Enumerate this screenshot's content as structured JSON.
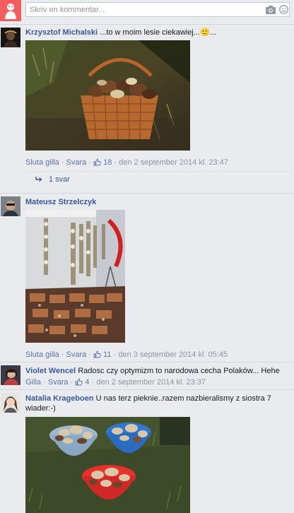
{
  "composer": {
    "placeholder": "Skriv en kommentar..."
  },
  "comments": [
    {
      "author": "Krzysztof Michalski",
      "text": "...to w moim lesie ciekawiej...",
      "emoji": "🙂",
      "text_tail": "...",
      "actions": {
        "hide": "Sluta gilla",
        "reply": "Svara",
        "likes": "18",
        "date": "den 2 september 2014 kl. 23:47"
      },
      "replies_label": "1 svar"
    },
    {
      "author": "Mateusz Strzelczyk",
      "text": "",
      "actions": {
        "hide": "Sluta gilla",
        "reply": "Svara",
        "likes": "11",
        "date": "den 3 september 2014 kl. 05:45"
      }
    },
    {
      "author": "Violet Wencel",
      "text": "Radosc czy optymizm to narodowa cecha Polaków... Hehe",
      "actions": {
        "hide": "Gilla",
        "reply": "Svara",
        "likes": "4",
        "date": "den 2 september 2014 kl. 23:37"
      }
    },
    {
      "author": "Natalia Krageboen",
      "text_line1": "U nas terz pieknie..razem nazbieralismy z siostra 7",
      "text_line2": "wiader:-)"
    }
  ],
  "sep": "·",
  "icons": {
    "camera": "camera-icon",
    "emoji": "smiley-icon",
    "like": "thumbs-up-icon",
    "reply_arrow": "reply-arrow-icon"
  },
  "colors": {
    "link": "#3b5998",
    "meta_link": "#5b74a8",
    "muted": "#90949c",
    "background": "#e9ebee"
  }
}
